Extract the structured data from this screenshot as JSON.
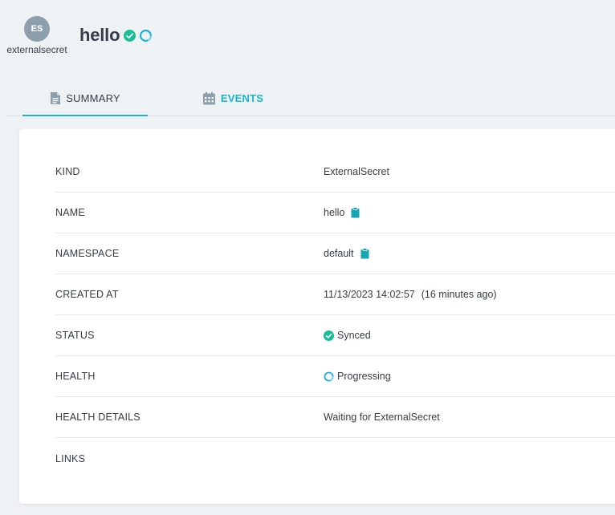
{
  "header": {
    "kind_abbrev": "ES",
    "kind_name": "externalsecret",
    "title": "hello",
    "sync_icon": "check-circle-icon",
    "health_icon": "progressing-circle-icon"
  },
  "tabs": [
    {
      "label": "SUMMARY",
      "icon": "document-icon",
      "active": true
    },
    {
      "label": "EVENTS",
      "icon": "calendar-icon",
      "active": false
    }
  ],
  "colors": {
    "accent": "#18b7cd",
    "synced": "#18be94",
    "progressing": "#0dadea",
    "background": "#eff2f5"
  },
  "summary": {
    "kind": {
      "key": "KIND",
      "value": "ExternalSecret"
    },
    "name": {
      "key": "NAME",
      "value": "hello"
    },
    "namespace": {
      "key": "NAMESPACE",
      "value": "default"
    },
    "created_at": {
      "key": "CREATED AT",
      "value": "11/13/2023 14:02:57",
      "ago": "(16 minutes ago)"
    },
    "status": {
      "key": "STATUS",
      "value": "Synced"
    },
    "health": {
      "key": "HEALTH",
      "value": "Progressing"
    },
    "health_details": {
      "key": "HEALTH DETAILS",
      "value": "Waiting for ExternalSecret"
    },
    "links": {
      "key": "LINKS",
      "value": ""
    }
  }
}
